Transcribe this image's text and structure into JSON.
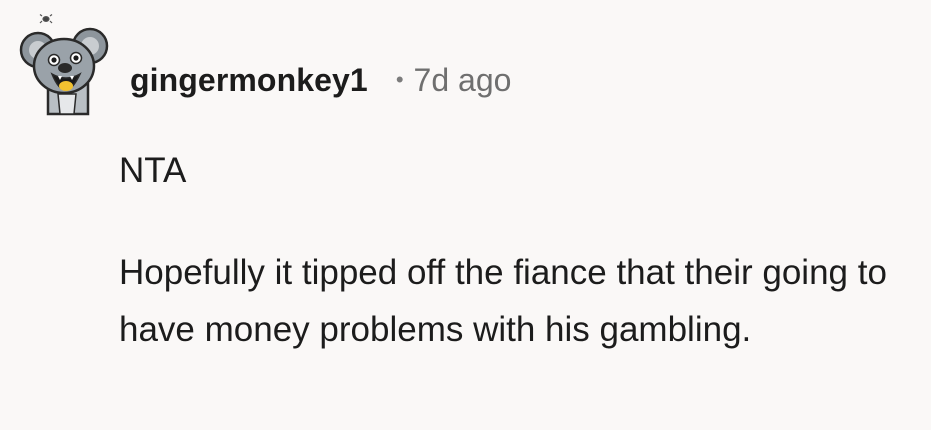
{
  "comment": {
    "avatar_icon": "koala-avatar-icon",
    "username": "gingermonkey1",
    "separator": "•",
    "timestamp": "7d ago",
    "paragraphs": [
      "NTA",
      "Hopefully it tipped off the fiance that their going to have money problems with his gambling."
    ]
  }
}
